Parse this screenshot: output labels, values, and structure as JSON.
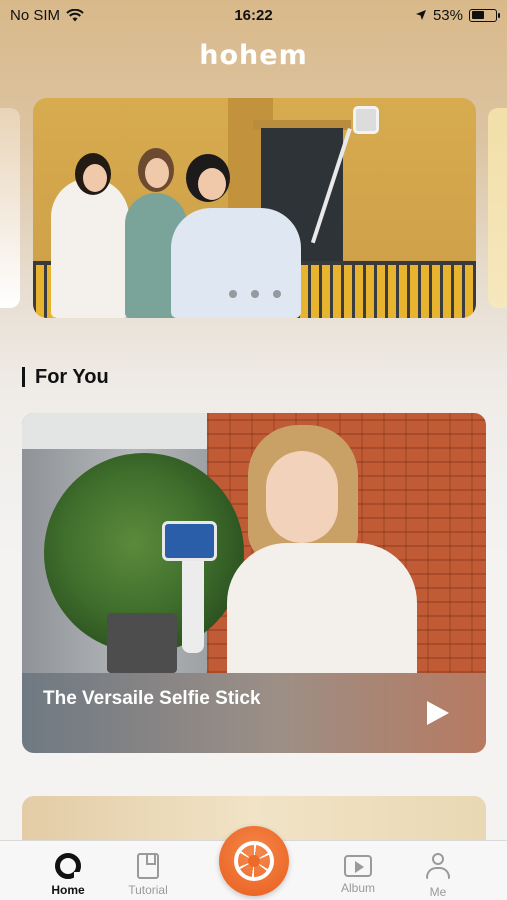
{
  "status_bar": {
    "carrier": "No SIM",
    "time": "16:22",
    "battery_percent": "53%",
    "battery_level": 0.53
  },
  "header": {
    "logo": "hohem"
  },
  "carousel": {
    "slide_count": 3,
    "active_index": 1
  },
  "section": {
    "title": "For You"
  },
  "featured_video": {
    "title": "The Versaile Selfie Stick",
    "icon": "play-icon"
  },
  "tabbar": {
    "tabs": [
      {
        "label": "Home",
        "icon": "home-icon",
        "active": true
      },
      {
        "label": "Tutorial",
        "icon": "tutorial-icon",
        "active": false
      },
      {
        "label": "Album",
        "icon": "album-icon",
        "active": false
      },
      {
        "label": "Me",
        "icon": "me-icon",
        "active": false
      }
    ],
    "center_button_icon": "camera-shutter-icon"
  },
  "colors": {
    "accent": "#ec6a2a",
    "tab_active": "#111111",
    "tab_inactive": "#9a9a9a"
  }
}
